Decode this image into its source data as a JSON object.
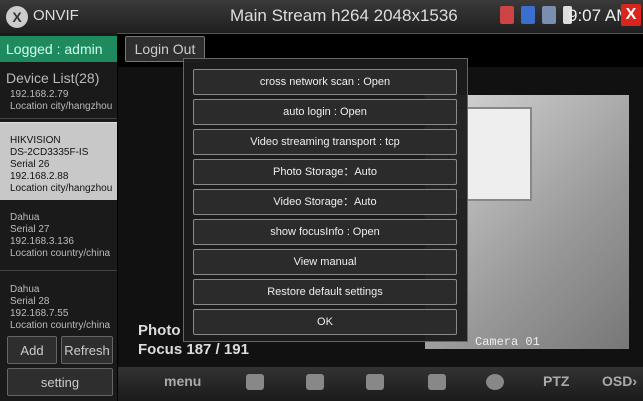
{
  "topbar": {
    "app_name": "ONVIF",
    "logo": "X",
    "title": "Main Stream h264 2048x1536",
    "time": "9:07 AM",
    "close": "X"
  },
  "sidebar": {
    "logged": "Logged : admin",
    "device_list": "Device List(28)",
    "devices": [
      {
        "lines": [
          "192.168.2.79",
          "Location city/hangzhou"
        ]
      },
      {
        "lines": [
          "HIKVISION",
          "DS-2CD3335F-IS",
          "Serial 26",
          "192.168.2.88",
          "Location city/hangzhou"
        ]
      },
      {
        "lines": [
          "Dahua",
          "Serial 27",
          "192.168.3.136",
          "Location country/china"
        ]
      },
      {
        "lines": [
          "Dahua",
          "Serial 28",
          "192.168.7.55",
          "Location country/china"
        ]
      }
    ],
    "add": "Add",
    "refresh": "Refresh",
    "setting": "setting"
  },
  "login_out": "Login Out",
  "video": {
    "photo": "Photo",
    "focus": "Focus",
    "focus_value": "187 / 191",
    "camera": "Camera 01"
  },
  "dialog": {
    "options": [
      "cross network scan : Open",
      "auto login   : Open",
      "Video streaming transport : tcp",
      "Photo Storage：Auto",
      "Video Storage：Auto",
      "show focusInfo   : Open",
      "View manual",
      "Restore default settings",
      "OK"
    ]
  },
  "bottombar": {
    "menu": "menu",
    "ptz": "PTZ",
    "osd": "OSD"
  }
}
